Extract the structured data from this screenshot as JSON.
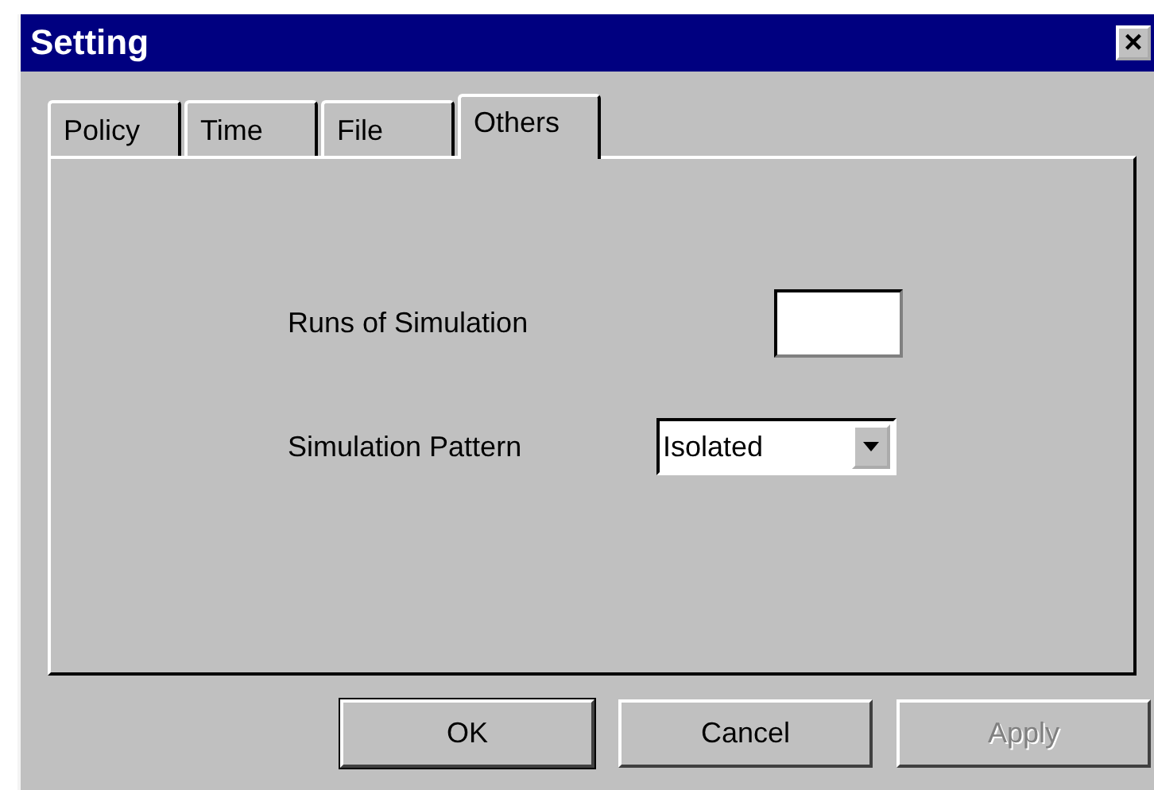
{
  "window": {
    "title": "Setting",
    "close": "×"
  },
  "tabs": [
    {
      "label": "Policy",
      "selected": false
    },
    {
      "label": "Time",
      "selected": false
    },
    {
      "label": "File",
      "selected": false
    },
    {
      "label": "Others",
      "selected": true
    }
  ],
  "fields": [
    {
      "kind": "text",
      "label": "Runs of Simulation"
    },
    {
      "kind": "dropdown",
      "label": "Simulation Pattern",
      "value": "Isolated"
    }
  ],
  "buttons": [
    {
      "label": "OK",
      "default": true,
      "disabled": false
    },
    {
      "label": "Cancel",
      "default": false,
      "disabled": false
    },
    {
      "label": "Apply",
      "default": false,
      "disabled": true
    }
  ]
}
